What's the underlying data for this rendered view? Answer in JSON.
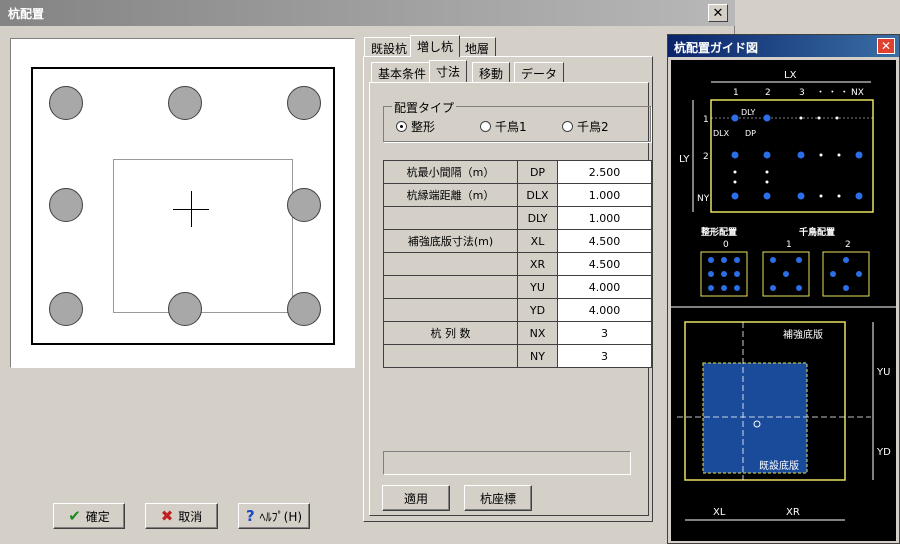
{
  "window": {
    "title": "杭配置"
  },
  "buttons": {
    "ok": "確定",
    "cancel": "取消",
    "help": "ﾍﾙﾌﾟ(H)",
    "apply": "適用",
    "pile_coords": "杭座標"
  },
  "tabs_top": [
    "既設杭",
    "増し杭",
    "地層"
  ],
  "tabs_sub": [
    "基本条件",
    "寸法",
    "移動",
    "データ"
  ],
  "layout_type": {
    "label": "配置タイプ",
    "options": [
      "整形",
      "千鳥1",
      "千鳥2"
    ],
    "selected": "整形"
  },
  "table": {
    "rows": [
      {
        "label": "杭最小間隔（m）",
        "key": "DP",
        "value": "2.500"
      },
      {
        "label": "杭縁端距離（m）",
        "key": "DLX",
        "value": "1.000"
      },
      {
        "label": "",
        "key": "DLY",
        "value": "1.000"
      },
      {
        "label": "補強底版寸法(m)",
        "key": "XL",
        "value": "4.500"
      },
      {
        "label": "",
        "key": "XR",
        "value": "4.500"
      },
      {
        "label": "",
        "key": "YU",
        "value": "4.000"
      },
      {
        "label": "",
        "key": "YD",
        "value": "4.000"
      },
      {
        "label": "杭 列 数",
        "key": "NX",
        "value": "3"
      },
      {
        "label": "",
        "key": "NY",
        "value": "3"
      }
    ]
  },
  "guide": {
    "title": "杭配置ガイド図",
    "lx": "LX",
    "ly": "LY",
    "nx": "NX",
    "ny": "NY",
    "dly": "DLY",
    "dlx": "DLX",
    "dp": "DP",
    "col_nums": [
      "1",
      "2",
      "3"
    ],
    "row_nums": [
      "1",
      "2"
    ],
    "dots": "・ ・ ・",
    "regular_label": "整形配置",
    "stagger_label": "千鳥配置",
    "type_nums": [
      "0",
      "1",
      "2"
    ],
    "reinforce": "補強底版",
    "existing": "既設底版",
    "origin": "O",
    "yu": "YU",
    "yd": "YD",
    "xl": "XL",
    "xr": "XR"
  },
  "colors": {
    "accent_blue": "#2a6ee8",
    "guide_yellow": "#e8e060",
    "title_blue": "#0a246a"
  }
}
